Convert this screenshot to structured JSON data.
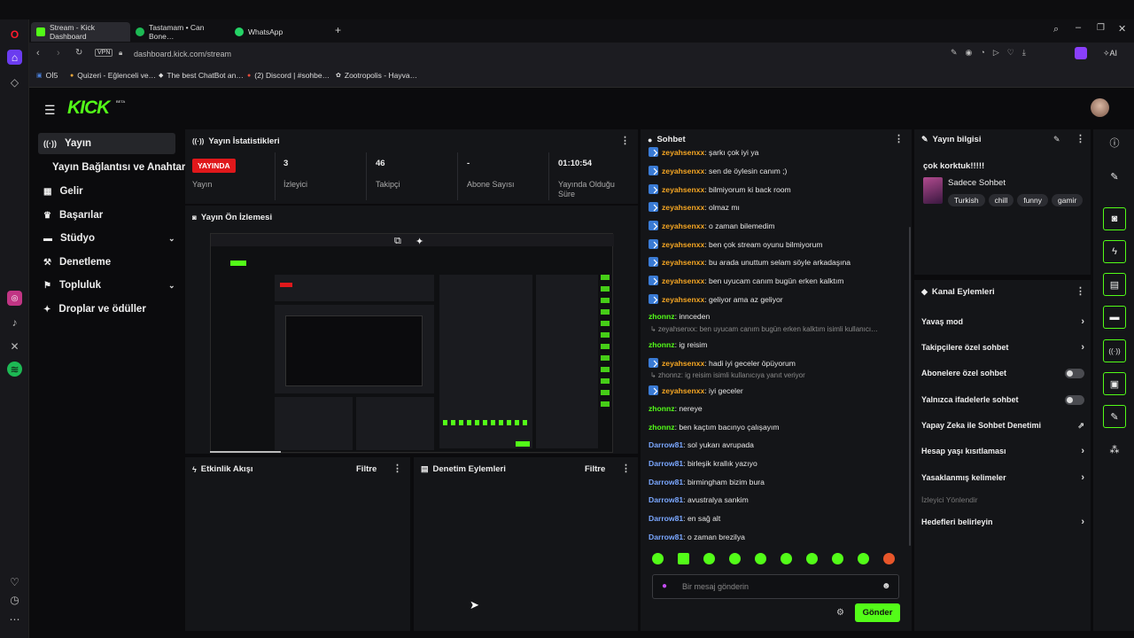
{
  "browser": {
    "tabs": [
      {
        "label": "Stream - Kick Dashboard",
        "active": true
      },
      {
        "label": "Tastamam • Can Bone…",
        "active": false
      },
      {
        "label": "WhatsApp",
        "active": false
      }
    ],
    "url": "dashboard.kick.com/stream",
    "vpn_label": "VPN",
    "ai_label": "AI",
    "bookmarks": [
      "Oİ5",
      "Quizeri - Eğlenceli ve…",
      "The best ChatBot an…",
      "(2) Discord | #sohbe…",
      "Zootropolis - Hayva…"
    ]
  },
  "brand": {
    "logo": "KICK",
    "beta": "BETA",
    "accent": "#53fc18"
  },
  "sidebar": {
    "items": [
      {
        "label": "Yayın",
        "icon": "broadcast-icon",
        "active": true
      },
      {
        "label": "Yayın Bağlantısı ve Anahtarı",
        "icon": "",
        "active": false
      },
      {
        "label": "Gelir",
        "icon": "revenue-icon",
        "active": false
      },
      {
        "label": "Başarılar",
        "icon": "trophy-icon",
        "active": false
      },
      {
        "label": "Stüdyo",
        "icon": "studio-icon",
        "active": false,
        "expand": true
      },
      {
        "label": "Denetleme",
        "icon": "moderation-icon",
        "active": false
      },
      {
        "label": "Topluluk",
        "icon": "community-icon",
        "active": false,
        "expand": true
      },
      {
        "label": "Droplar ve ödüller",
        "icon": "drops-icon",
        "active": false
      }
    ]
  },
  "stats": {
    "title": "Yayın İstatistikleri",
    "live_badge": "YAYINDA",
    "live_label": "Yayın",
    "viewers_value": "3",
    "viewers_label": "İzleyici",
    "followers_value": "46",
    "followers_label": "Takipçi",
    "subs_value": "-",
    "subs_label": "Abone Sayısı",
    "uptime_value": "01:10:54",
    "uptime_label": "Yayında Olduğu Süre"
  },
  "preview": {
    "title": "Yayın Ön İzlemesi"
  },
  "activity": {
    "title": "Etkinlik Akışı",
    "filter": "Filtre"
  },
  "modlog": {
    "title": "Denetim Eylemleri",
    "filter": "Filtre"
  },
  "chat": {
    "title": "Sohbet",
    "messages": [
      {
        "user": "zeyahsenxx",
        "text": ": şarkı çok iyi ya",
        "color": "orange",
        "badge": true
      },
      {
        "user": "zeyahsenxx",
        "text": ": sen de öylesin canım ;)",
        "color": "orange",
        "badge": true
      },
      {
        "user": "zeyahsenxx",
        "text": ": bilmiyorum ki back room",
        "color": "orange",
        "badge": true
      },
      {
        "user": "zeyahsenxx",
        "text": ": olmaz mı",
        "color": "orange",
        "badge": true
      },
      {
        "user": "zeyahsenxx",
        "text": ": o zaman bilemedim",
        "color": "orange",
        "badge": true
      },
      {
        "user": "zeyahsenxx",
        "text": ": ben çok stream oyunu bilmiyorum",
        "color": "orange",
        "badge": true
      },
      {
        "user": "zeyahsenxx",
        "text": ": bu arada unuttum selam söyle arkadaşına",
        "color": "orange",
        "badge": true
      },
      {
        "user": "zeyahsenxx",
        "text": ": ben uyucam canım bugün erken kalktım",
        "color": "orange",
        "badge": true
      },
      {
        "user": "zeyahsenxx",
        "text": ": geliyor ama az geliyor",
        "color": "orange",
        "badge": true
      },
      {
        "user": "zhonnz",
        "text": ": innceden",
        "color": "green",
        "badge": false
      },
      {
        "reply": "↳ zeyahsenxx: ben uyucam canım bugün erken kalktım isimli kullanıcı…"
      },
      {
        "user": "zhonnz",
        "text": ": ig reisim",
        "color": "green",
        "badge": false
      },
      {
        "user": "zeyahsenxx",
        "text": ": hadi iyi geceler öpüyorum",
        "color": "orange",
        "badge": true
      },
      {
        "reply": "↳ zhonnz: ig reisim isimli kullanıcıya yanıt veriyor"
      },
      {
        "user": "zeyahsenxx",
        "text": ": iyi geceler",
        "color": "orange",
        "badge": true
      },
      {
        "user": "zhonnz",
        "text": ": nereye",
        "color": "green",
        "badge": false
      },
      {
        "user": "zhonnz",
        "text": ": ben kaçtım bacınyo çalışayım",
        "color": "green",
        "badge": false
      },
      {
        "user": "Darrow81",
        "text": ": sol yukarı avrupada",
        "color": "blue",
        "badge": false
      },
      {
        "user": "Darrow81",
        "text": ": birleşik krallık yazıyo",
        "color": "blue",
        "badge": false
      },
      {
        "user": "Darrow81",
        "text": ": birmingham bizim bura",
        "color": "blue",
        "badge": false
      },
      {
        "user": "Darrow81",
        "text": ": avustralya sankim",
        "color": "blue",
        "badge": false
      },
      {
        "user": "Darrow81",
        "text": ": en sağ alt",
        "color": "blue",
        "badge": false
      },
      {
        "user": "Darrow81",
        "text": ": o zaman brezilya",
        "color": "blue",
        "badge": false
      }
    ],
    "input_placeholder": "Bir mesaj gönderin",
    "send_label": "Gönder"
  },
  "stream_info": {
    "title": "Yayın bilgisi",
    "stream_title": "çok korktuk!!!!!",
    "category": "Sadece Sohbet",
    "tags": [
      "Turkish",
      "chill",
      "funny",
      "gamir"
    ]
  },
  "channel_actions": {
    "title": "Kanal Eylemleri",
    "items": [
      {
        "label": "Yavaş mod",
        "kind": "arrow"
      },
      {
        "label": "Takipçilere özel sohbet",
        "kind": "arrow"
      },
      {
        "label": "Abonelere özel sohbet",
        "kind": "toggle"
      },
      {
        "label": "Yalnızca ifadelerle sohbet",
        "kind": "toggle"
      },
      {
        "label": "Yapay Zeka ile Sohbet Denetimi",
        "kind": "external"
      },
      {
        "label": "Hesap yaşı kısıtlaması",
        "kind": "arrow"
      },
      {
        "label": "Yasaklanmış kelimeler",
        "kind": "arrow"
      }
    ],
    "section_label": "İzleyici Yönlendir",
    "goals_label": "Hedefleri belirleyin"
  }
}
